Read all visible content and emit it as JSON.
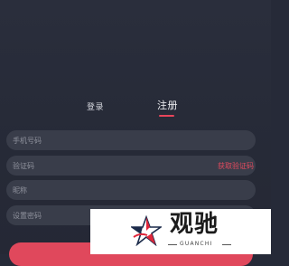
{
  "tabs": {
    "login_label": "登录",
    "register_label": "注册",
    "active": "register"
  },
  "form": {
    "phone_placeholder": "手机号码",
    "code_placeholder": "验证码",
    "get_code_label": "获取验证码",
    "nickname_placeholder": "昵称",
    "password_placeholder": "设置密码"
  },
  "watermark": {
    "title": "观驰",
    "subtitle": "GUANCHI",
    "icon": "star-logo-icon"
  },
  "colors": {
    "background": "#262a38",
    "field": "#393d4a",
    "accent": "#e8455b"
  }
}
